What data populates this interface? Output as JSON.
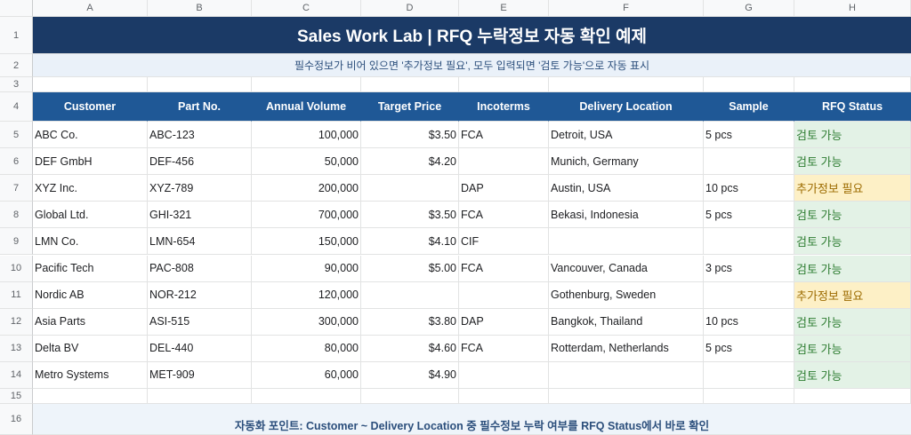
{
  "columns": [
    "A",
    "B",
    "C",
    "D",
    "E",
    "F",
    "G",
    "H"
  ],
  "rows_num": {
    "r1": "1",
    "r2": "2",
    "r3": "3",
    "r4": "4",
    "r15": "15",
    "r16": "16"
  },
  "title": "Sales Work Lab | RFQ 누락정보 자동 확인 예제",
  "subtitle": "필수정보가 비어 있으면 '추가정보 필요', 모두 입력되면 '검토 가능'으로 자동 표시",
  "headers": [
    "Customer",
    "Part No.",
    "Annual Volume",
    "Target Price",
    "Incoterms",
    "Delivery Location",
    "Sample",
    "RFQ Status"
  ],
  "rows": [
    {
      "n": "5",
      "customer": "ABC Co.",
      "part": "ABC-123",
      "volume": "100,000",
      "price": "$3.50",
      "incoterms": "FCA",
      "location": "Detroit, USA",
      "sample": "5 pcs",
      "status": "검토 가능"
    },
    {
      "n": "6",
      "customer": "DEF GmbH",
      "part": "DEF-456",
      "volume": "50,000",
      "price": "$4.20",
      "incoterms": "",
      "location": "Munich, Germany",
      "sample": "",
      "status": "검토 가능"
    },
    {
      "n": "7",
      "customer": "XYZ Inc.",
      "part": "XYZ-789",
      "volume": "200,000",
      "price": "",
      "incoterms": "DAP",
      "location": "Austin, USA",
      "sample": "10 pcs",
      "status": "추가정보 필요"
    },
    {
      "n": "8",
      "customer": "Global Ltd.",
      "part": "GHI-321",
      "volume": "700,000",
      "price": "$3.50",
      "incoterms": "FCA",
      "location": "Bekasi, Indonesia",
      "sample": "5 pcs",
      "status": "검토 가능"
    },
    {
      "n": "9",
      "customer": "LMN Co.",
      "part": "LMN-654",
      "volume": "150,000",
      "price": "$4.10",
      "incoterms": "CIF",
      "location": "",
      "sample": "",
      "status": "검토 가능"
    },
    {
      "n": "10",
      "customer": "Pacific Tech",
      "part": "PAC-808",
      "volume": "90,000",
      "price": "$5.00",
      "incoterms": "FCA",
      "location": "Vancouver, Canada",
      "sample": "3 pcs",
      "status": "검토 가능"
    },
    {
      "n": "11",
      "customer": "Nordic AB",
      "part": "NOR-212",
      "volume": "120,000",
      "price": "",
      "incoterms": "",
      "location": "Gothenburg, Sweden",
      "sample": "",
      "status": "추가정보 필요"
    },
    {
      "n": "12",
      "customer": "Asia Parts",
      "part": "ASI-515",
      "volume": "300,000",
      "price": "$3.80",
      "incoterms": "DAP",
      "location": "Bangkok, Thailand",
      "sample": "10 pcs",
      "status": "검토 가능"
    },
    {
      "n": "13",
      "customer": "Delta BV",
      "part": "DEL-440",
      "volume": "80,000",
      "price": "$4.60",
      "incoterms": "FCA",
      "location": "Rotterdam, Netherlands",
      "sample": "5 pcs",
      "status": "검토 가능"
    },
    {
      "n": "14",
      "customer": "Metro Systems",
      "part": "MET-909",
      "volume": "60,000",
      "price": "$4.90",
      "incoterms": "",
      "location": "",
      "sample": "",
      "status": "검토 가능"
    }
  ],
  "footer": "자동화 포인트: Customer ~ Delivery Location 중 필수정보 누락 여부를 RFQ Status에서 바로 확인",
  "colors": {
    "title_bg": "#1b3a66",
    "header_bg": "#1f5896",
    "ok_bg": "#e3f2e6",
    "need_bg": "#fdf0c6"
  }
}
